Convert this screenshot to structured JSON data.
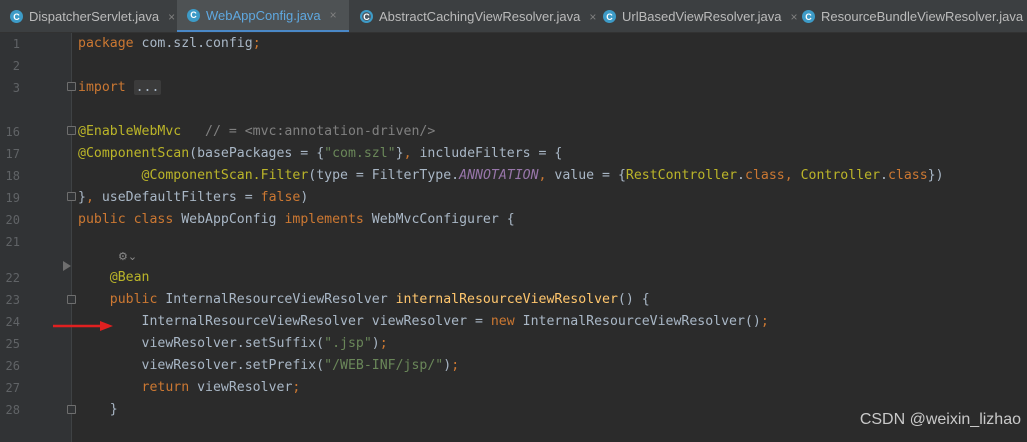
{
  "tabs": [
    {
      "name": "DispatcherServlet.java",
      "icon": "class-c-icon",
      "active": false
    },
    {
      "name": "WebAppConfig.java",
      "icon": "class-c-icon",
      "active": true
    },
    {
      "name": "AbstractCachingViewResolver.java",
      "icon": "abstract-class-icon",
      "active": false
    },
    {
      "name": "UrlBasedViewResolver.java",
      "icon": "class-c-icon",
      "active": false
    },
    {
      "name": "ResourceBundleViewResolver.java",
      "icon": "class-c-icon",
      "active": false
    }
  ],
  "close_glyph": "×",
  "icon_letter": "C",
  "lines": [
    {
      "n": "1",
      "code": [
        [
          "k",
          "package "
        ],
        [
          "p",
          "com.szl.config"
        ],
        [
          "k",
          ";"
        ]
      ]
    },
    {
      "n": "2",
      "code": []
    },
    {
      "n": "3",
      "code": [
        [
          "k",
          "import "
        ],
        [
          "d",
          "..."
        ]
      ]
    },
    {
      "n": "16",
      "code": [
        [
          "a",
          "@EnableWebMvc"
        ],
        [
          "c",
          "   // = <mvc:annotation-driven/>"
        ]
      ]
    },
    {
      "n": "17",
      "code": [
        [
          "a",
          "@ComponentScan"
        ],
        [
          "p",
          "(basePackages = {"
        ],
        [
          "s",
          "\"com.szl\""
        ],
        [
          "p",
          "}"
        ],
        [
          "k",
          ","
        ],
        [
          "p",
          " includeFilters = {"
        ]
      ]
    },
    {
      "n": "18",
      "code": [
        [
          "p",
          "        "
        ],
        [
          "a",
          "@ComponentScan.Filter"
        ],
        [
          "p",
          "(type = FilterType."
        ],
        [
          "i",
          "ANNOTATION"
        ],
        [
          "k",
          ","
        ],
        [
          "p",
          " value = {"
        ],
        [
          "a",
          "RestController"
        ],
        [
          "p",
          "."
        ],
        [
          "k",
          "class"
        ],
        [
          "k",
          ","
        ],
        [
          "p",
          " "
        ],
        [
          "a",
          "Controller"
        ],
        [
          "p",
          "."
        ],
        [
          "k",
          "class"
        ],
        [
          "p",
          "})"
        ]
      ]
    },
    {
      "n": "19",
      "code": [
        [
          "p",
          "}"
        ],
        [
          "k",
          ","
        ],
        [
          "p",
          " useDefaultFilters = "
        ],
        [
          "k",
          "false"
        ],
        [
          "p",
          ")"
        ]
      ]
    },
    {
      "n": "20",
      "code": [
        [
          "k",
          "public class "
        ],
        [
          "p",
          "WebAppConfig "
        ],
        [
          "k",
          "implements "
        ],
        [
          "p",
          "WebMvcConfigurer {"
        ]
      ]
    },
    {
      "n": "21",
      "code": []
    },
    {
      "n": "22",
      "code": [
        [
          "p",
          "    "
        ],
        [
          "a",
          "@Bean"
        ]
      ]
    },
    {
      "n": "23",
      "code": [
        [
          "p",
          "    "
        ],
        [
          "k",
          "public "
        ],
        [
          "p",
          "InternalResourceViewResolver "
        ],
        [
          "f",
          "internalResourceViewResolver"
        ],
        [
          "p",
          "() {"
        ]
      ]
    },
    {
      "n": "24",
      "code": [
        [
          "p",
          "        InternalResourceViewResolver viewResolver = "
        ],
        [
          "k",
          "new "
        ],
        [
          "p",
          "InternalResourceViewResolver()"
        ],
        [
          "k",
          ";"
        ]
      ]
    },
    {
      "n": "25",
      "code": [
        [
          "p",
          "        viewResolver.setSuffix("
        ],
        [
          "s",
          "\".jsp\""
        ],
        [
          "p",
          ")"
        ],
        [
          "k",
          ";"
        ]
      ]
    },
    {
      "n": "26",
      "code": [
        [
          "p",
          "        viewResolver.setPrefix("
        ],
        [
          "s",
          "\"/WEB-INF/jsp/\""
        ],
        [
          "p",
          ")"
        ],
        [
          "k",
          ";"
        ]
      ]
    },
    {
      "n": "27",
      "code": [
        [
          "p",
          "        "
        ],
        [
          "k",
          "return "
        ],
        [
          "p",
          "viewResolver"
        ],
        [
          "k",
          ";"
        ]
      ]
    },
    {
      "n": "28",
      "code": [
        [
          "p",
          "    }"
        ]
      ]
    }
  ],
  "hint_glyph": "⚙⌄",
  "watermark": "CSDN @weixin_lizhao",
  "colors": {
    "keyword": "#cc7832",
    "string": "#6a8759",
    "annotation": "#bbb529",
    "comment": "#808080",
    "constant": "#9876aa",
    "method": "#ffc66d",
    "text": "#a9b7c6",
    "arrow": "#e02020",
    "accent": "#4a88c7"
  }
}
